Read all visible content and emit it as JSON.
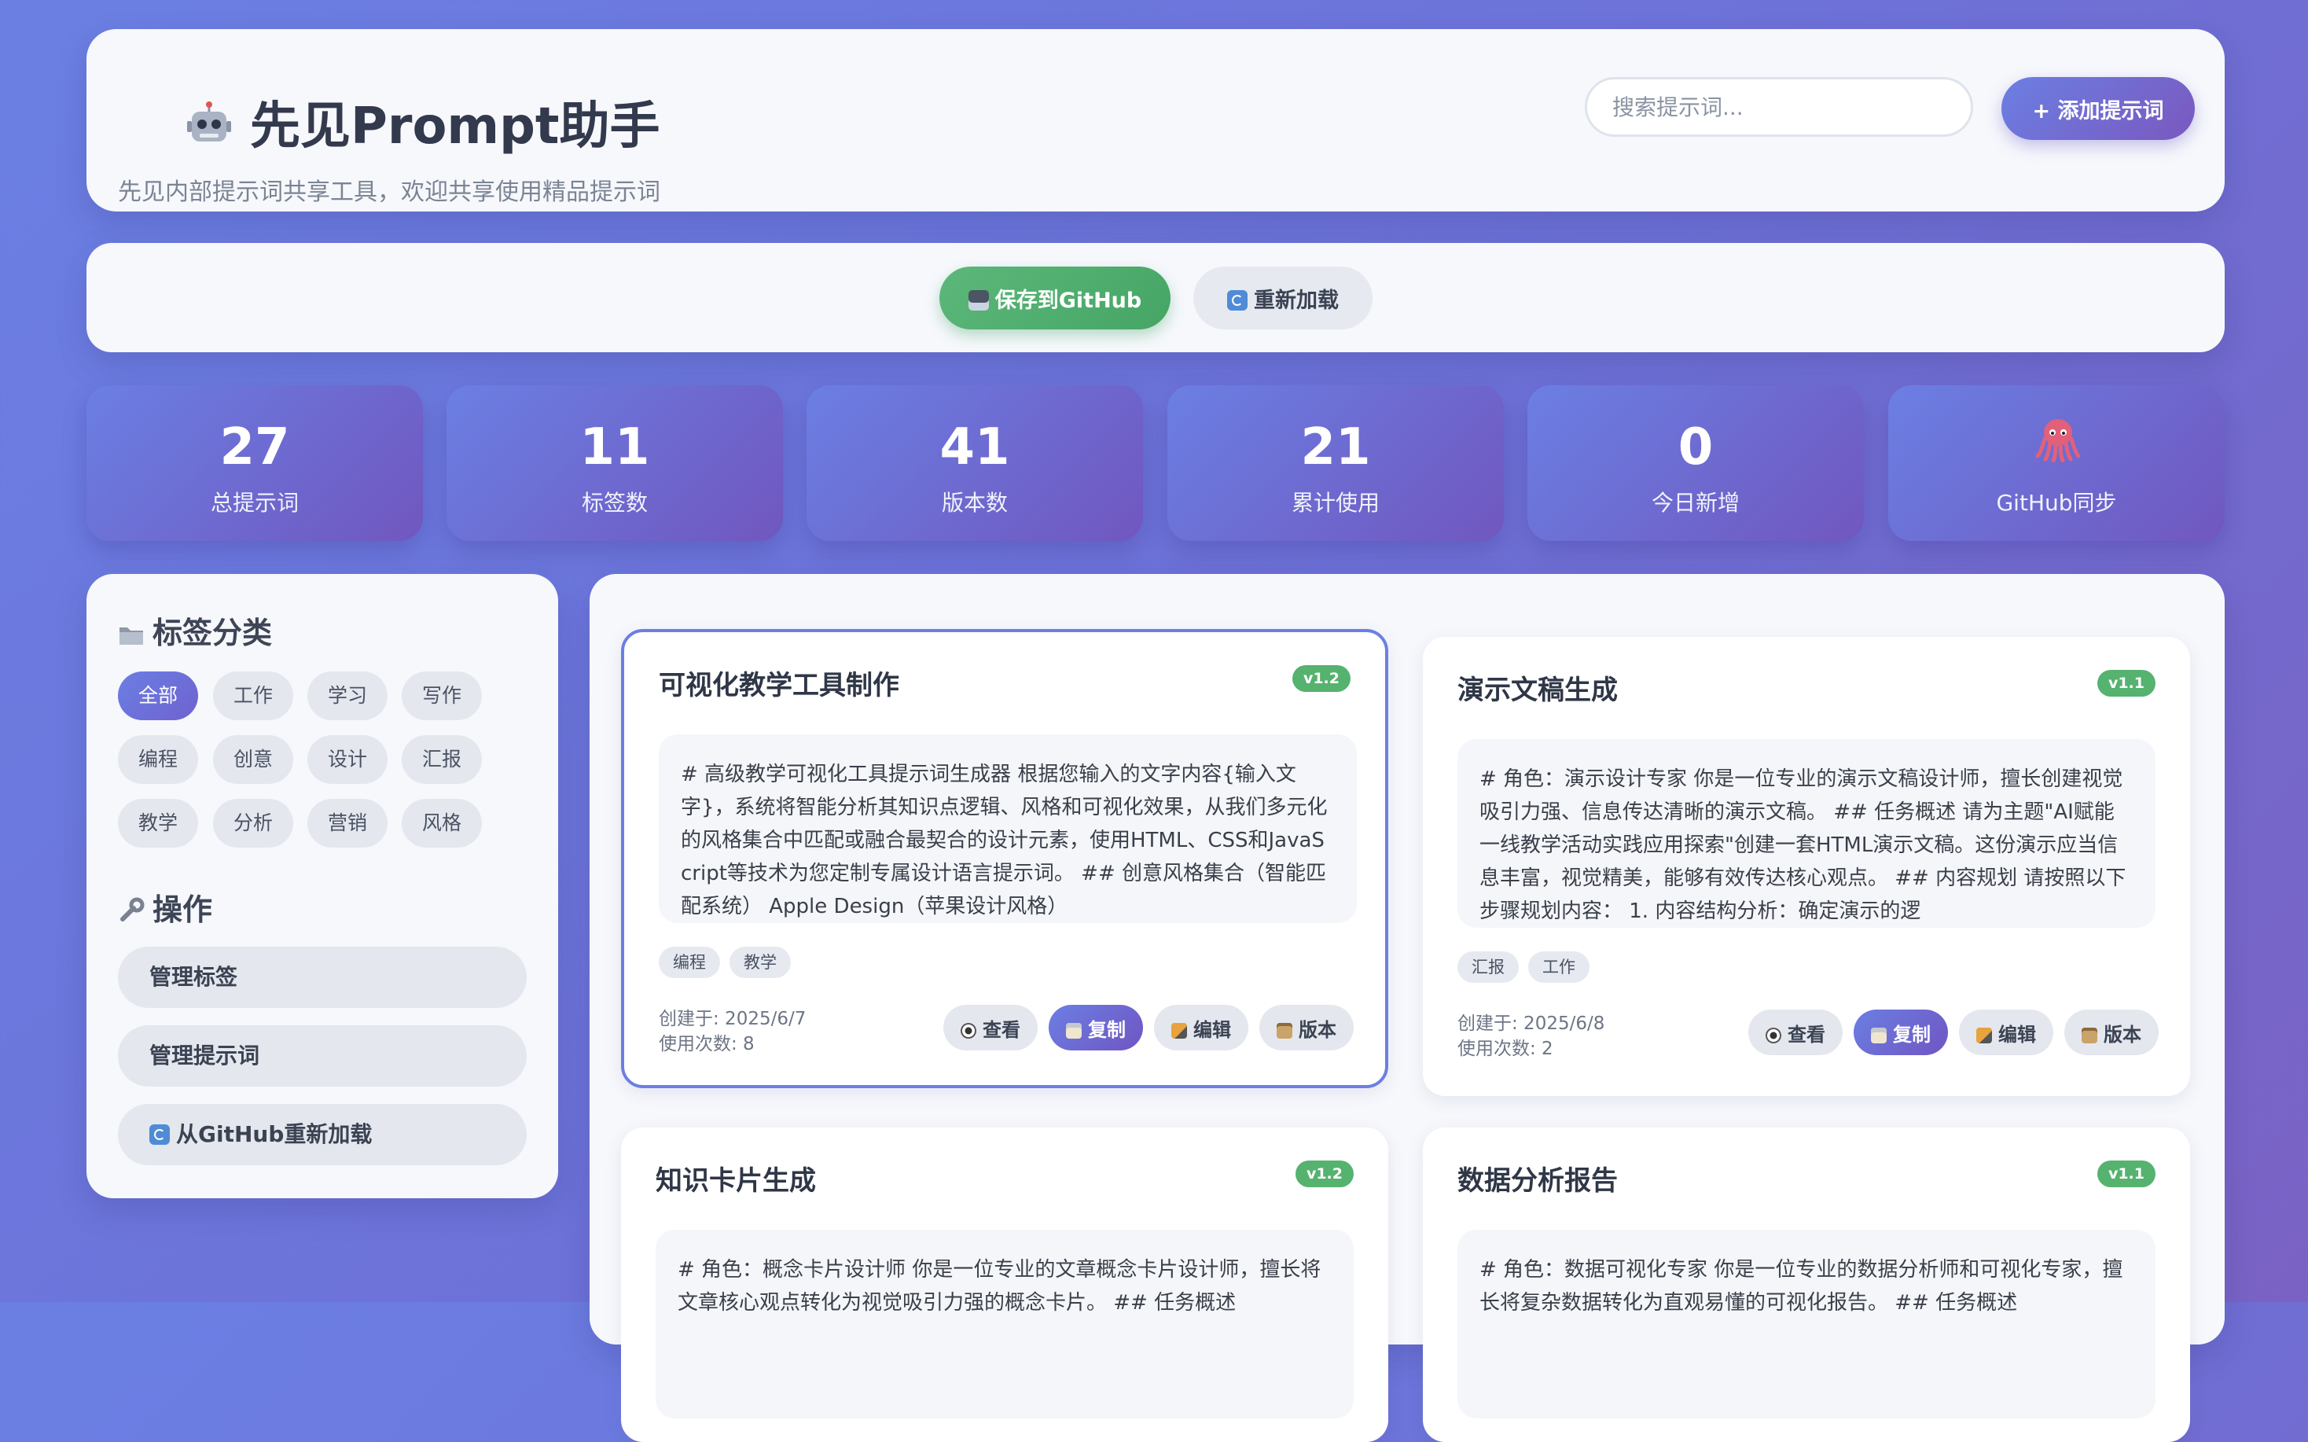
{
  "header": {
    "title": "先见Prompt助手",
    "subtitle": "先见内部提示词共享工具，欢迎共享使用精品提示词",
    "search_placeholder": "搜索提示词...",
    "add_label": "+ 添加提示词"
  },
  "toolbar": {
    "save_label": "保存到GitHub",
    "reload_label": "重新加载"
  },
  "stats": [
    {
      "value": "27",
      "label": "总提示词"
    },
    {
      "value": "11",
      "label": "标签数"
    },
    {
      "value": "41",
      "label": "版本数"
    },
    {
      "value": "21",
      "label": "累计使用"
    },
    {
      "value": "0",
      "label": "今日新增"
    },
    {
      "value": "",
      "label": "GitHub同步",
      "icon": "octopus-icon"
    }
  ],
  "sidebar": {
    "tags_title": "标签分类",
    "tags": [
      "全部",
      "工作",
      "学习",
      "写作",
      "编程",
      "创意",
      "设计",
      "汇报",
      "教学",
      "分析",
      "营销",
      "风格"
    ],
    "ops_title": "操作",
    "ops": [
      "管理标签",
      "管理提示词",
      "从GitHub重新加载"
    ]
  },
  "actions": {
    "view": "查看",
    "copy": "复制",
    "edit": "编辑",
    "version": "版本"
  },
  "cards": [
    {
      "title": "可视化教学工具制作",
      "version": "v1.2",
      "content": "# 高级教学可视化工具提示词生成器 根据您输入的文字内容{输入文字}，系统将智能分析其知识点逻辑、风格和可视化效果，从我们多元化的风格集合中匹配或融合最契合的设计元素，使用HTML、CSS和JavaScript等技术为您定制专属设计语言提示词。 ## 创意风格集合（智能匹配系统） Apple Design（苹果设计风格）",
      "tags": [
        "编程",
        "教学"
      ],
      "created": "创建于: 2025/6/7",
      "usage": "使用次数: 8"
    },
    {
      "title": "演示文稿生成",
      "version": "v1.1",
      "content": "# 角色：演示设计专家 你是一位专业的演示文稿设计师，擅长创建视觉吸引力强、信息传达清晰的演示文稿。 ## 任务概述 请为主题\"AI赋能一线教学活动实践应用探索\"创建一套HTML演示文稿。这份演示应当信息丰富，视觉精美，能够有效传达核心观点。 ## 内容规划 请按照以下步骤规划内容： 1. 内容结构分析：确定演示的逻",
      "tags": [
        "汇报",
        "工作"
      ],
      "created": "创建于: 2025/6/8",
      "usage": "使用次数: 2"
    },
    {
      "title": "知识卡片生成",
      "version": "v1.2",
      "content": "# 角色：概念卡片设计师 你是一位专业的文章概念卡片设计师，擅长将文章核心观点转化为视觉吸引力强的概念卡片。 ## 任务概述"
    },
    {
      "title": "数据分析报告",
      "version": "v1.1",
      "content": "# 角色：数据可视化专家 你是一位专业的数据分析师和可视化专家，擅长将复杂数据转化为直观易懂的可视化报告。 ## 任务概述"
    }
  ]
}
